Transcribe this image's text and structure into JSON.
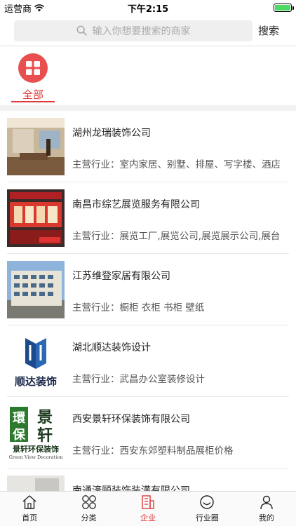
{
  "status": {
    "carrier": "运营商",
    "time": "下午2:15"
  },
  "search": {
    "placeholder": "输入你想要搜索的商家",
    "button": "搜索"
  },
  "categories": [
    {
      "label": "全部",
      "icon": "grid-icon",
      "color": "#e84f4f"
    }
  ],
  "companies": [
    {
      "name": "湖州龙瑞装饰公司",
      "desc": "主营行业：室内家居、别墅、排屋、写字楼、酒店"
    },
    {
      "name": "南昌市综艺展览服务有限公司",
      "desc": "主营行业：展览工厂,展览公司,展览展示公司,展台"
    },
    {
      "name": "江苏维登家居有限公司",
      "desc": "主营行业：橱柜 衣柜 书柜 壁纸"
    },
    {
      "name": "湖北顺达装饰设计",
      "desc": "主营行业：武昌办公室装修设计"
    },
    {
      "name": "西安景轩环保装饰有限公司",
      "desc": "主营行业：西安东郊塑料制品展柜价格"
    },
    {
      "name": "南通濠顾装饰装潢有限公司",
      "desc": ""
    }
  ],
  "logos": {
    "shunda": "顺达装饰",
    "jingxuan_top": "環景",
    "jingxuan_bottom": "保轩",
    "jingxuan_cn": "景轩环保装饰",
    "jingxuan_en": "Green View Decoration"
  },
  "tabs": [
    {
      "label": "首页",
      "icon": "home-icon"
    },
    {
      "label": "分类",
      "icon": "category-icon"
    },
    {
      "label": "企业",
      "icon": "enterprise-icon",
      "active": true
    },
    {
      "label": "行业圈",
      "icon": "smile-circle-icon"
    },
    {
      "label": "我的",
      "icon": "user-icon"
    }
  ],
  "accent": "#e03a3a"
}
